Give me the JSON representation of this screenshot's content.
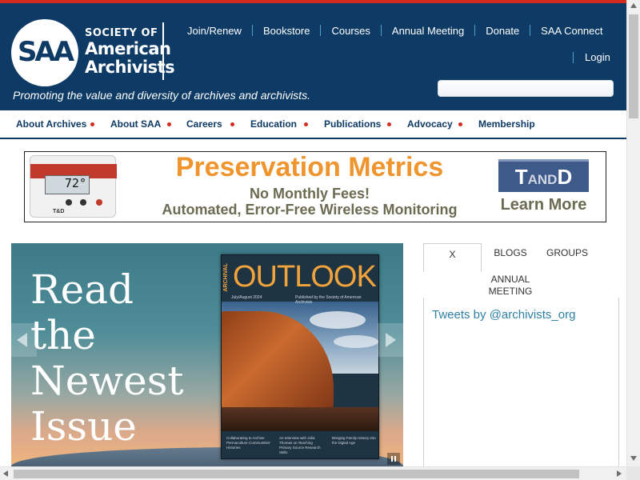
{
  "header": {
    "logo": {
      "letters": "SAA",
      "line1": "SOCIETY OF",
      "line2": "American",
      "line3": "Archivists"
    },
    "tagline": "Promoting the value and diversity of archives and archivists.",
    "utility_nav": [
      "Join/Renew",
      "Bookstore",
      "Courses",
      "Annual Meeting",
      "Donate",
      "SAA Connect"
    ],
    "login": "Login",
    "search": {
      "placeholder": "",
      "value": ""
    }
  },
  "main_nav": [
    "About Archives",
    "About SAA",
    "Careers",
    "Education",
    "Publications",
    "Advocacy",
    "Membership"
  ],
  "ad": {
    "title": "Preservation Metrics",
    "line1": "No Monthly Fees!",
    "line2": "Automated, Error-Free Wireless Monitoring",
    "logo_left": "T",
    "logo_mid": "AND",
    "logo_right": "D",
    "cta": "Learn More",
    "device_reading": "72°",
    "device_mark": "T&D"
  },
  "hero": {
    "lines": [
      "Read",
      "the",
      "Newest",
      "Issue"
    ],
    "magazine": {
      "title": "OUTLOOK",
      "series": "ARCHIVAL",
      "issue": "July/August 2024",
      "publisher": "Published by the Society of American Archivists",
      "features": [
        "Collaborating to Archive Permaculture Communities' Histories",
        "An Interview with Julia Thomas on Teaching Primary Source Research Skills",
        "Bringing Family History into the Digital Age"
      ]
    }
  },
  "tabs": {
    "x": "X",
    "blogs": "BLOGS",
    "groups": "GROUPS",
    "meeting_line1": "ANNUAL",
    "meeting_line2": "MEETING"
  },
  "widget": {
    "link": "Tweets by @archivists_org"
  },
  "colors": {
    "header_bg": "#0e3a66",
    "accent_red": "#d52b1e",
    "ad_orange": "#f0952e",
    "link_teal": "#2e7fa3"
  }
}
